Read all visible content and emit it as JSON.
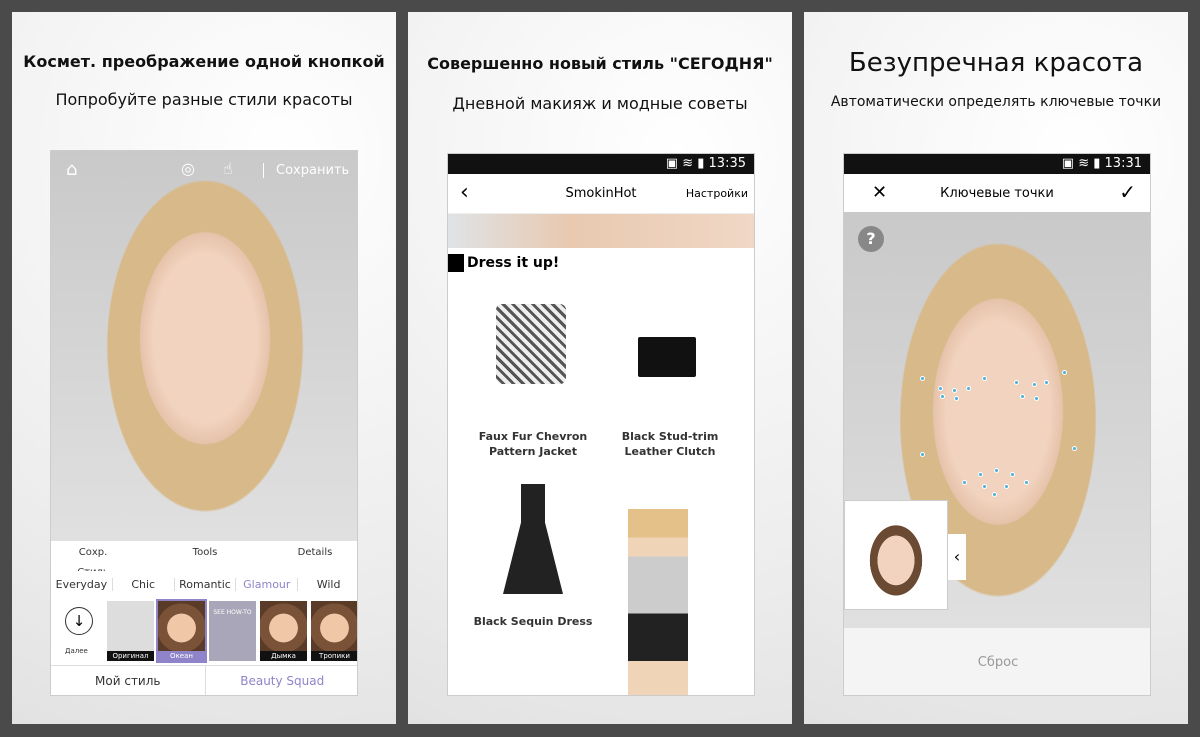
{
  "panel1": {
    "title": "Космет. преображение одной кнопкой",
    "subtitle": "Попробуйте разные стили красоты",
    "topbar": {
      "save": "Сохранить",
      "icons": [
        "home-icon",
        "compare-icon",
        "touch-icon"
      ]
    },
    "pills": [
      "Сохр. Стиль",
      "Tools",
      "Details"
    ],
    "style_tabs": [
      "Everyday",
      "Chic",
      "Romantic",
      "Glamour",
      "Wild"
    ],
    "active_tab": "Glamour",
    "download_label": "Далее",
    "looks": [
      "Оригинал",
      "Океан",
      "SEE HOW-TO",
      "Дымка",
      "Тропики"
    ],
    "selected_look": "Океан",
    "bottom_tabs": [
      "Мой стиль",
      "Beauty Squad"
    ],
    "accent": "#8f84c9"
  },
  "panel2": {
    "title": "Совершенно новый стиль \"СЕГОДНЯ\"",
    "subtitle": "Дневной макияж и модные советы",
    "time": "13:35",
    "header": "SmokinHot",
    "settings": "Настройки",
    "section": "Dress it up!",
    "products": [
      "Faux Fur Chevron Pattern Jacket",
      "Black Stud-trim Leather Clutch",
      "Black Sequin Dress"
    ]
  },
  "panel3": {
    "title": "Безупречная красота",
    "subtitle": "Автоматически определять ключевые точки",
    "time": "13:31",
    "header": "Ключевые точки",
    "help": "?",
    "reset": "Сброс"
  }
}
